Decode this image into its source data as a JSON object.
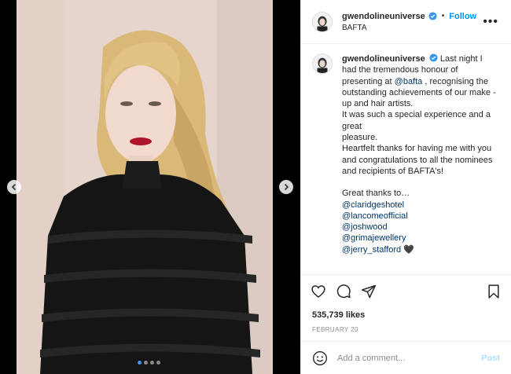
{
  "header": {
    "username": "gwendolineuniverse",
    "separator": "•",
    "follow_label": "Follow",
    "location": "BAFTA",
    "more_label": "•••"
  },
  "caption": {
    "username": "gwendolineuniverse",
    "text_1": "Last night I had the tremendous honour of presenting at ",
    "mention_bafta": "@bafta",
    "text_2": " , recognising the outstanding achievements of our make -up and hair artists.",
    "line_3": "It was such a special experience and a great",
    "line_4": "pleasure.",
    "line_5": "Heartfelt thanks for having me with you and congratulations to all the nominees and recipients of BAFTA's!",
    "line_6": "Great thanks to…",
    "mentions": [
      "@claridgeshotel",
      "@lancomeofficial",
      "@joshwood",
      "@grimajewellery",
      "@jerry_stafford"
    ],
    "heart_emoji": "🖤"
  },
  "likes": "535,739 likes",
  "date": "FEBRUARY 20",
  "comment": {
    "placeholder": "Add a comment...",
    "post_label": "Post"
  },
  "carousel": {
    "total": 4,
    "active": 1
  },
  "colors": {
    "link": "#0095f6",
    "mention": "#00376b",
    "muted": "#8e8e8e"
  }
}
